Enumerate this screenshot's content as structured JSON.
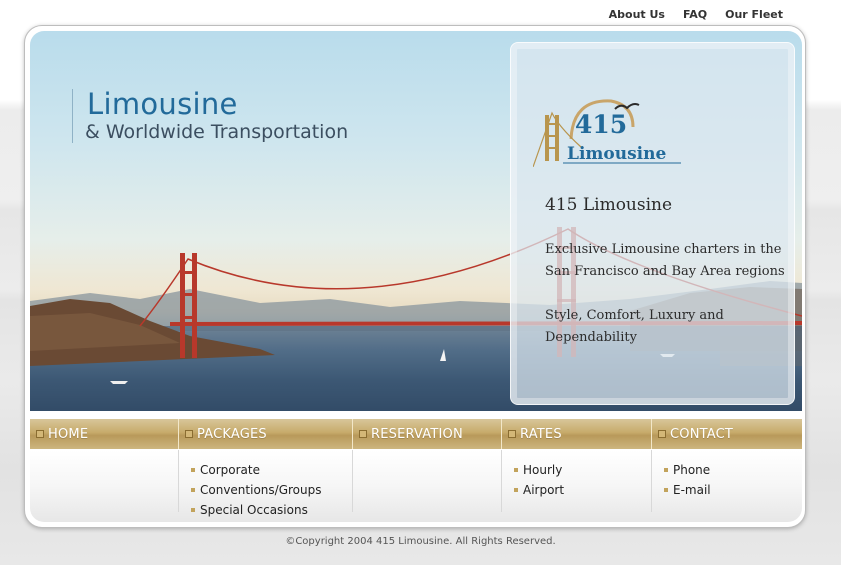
{
  "top_nav": [
    "About Us",
    "FAQ",
    "Our Fleet"
  ],
  "brand": {
    "title": "Limousine",
    "subtitle": "& Worldwide Transportation"
  },
  "logo": {
    "number": "415",
    "word": "Limousine"
  },
  "panel": {
    "heading": "415 Limousine",
    "para1": "Exclusive Limousine charters in the San Francisco and Bay Area regions",
    "para2": "Style, Comfort, Luxury and Dependability"
  },
  "menu": {
    "tabs": [
      {
        "label": "HOME",
        "items": []
      },
      {
        "label": "PACKAGES",
        "items": [
          "Corporate",
          "Conventions/Groups",
          "Special Occasions"
        ]
      },
      {
        "label": "RESERVATION",
        "items": []
      },
      {
        "label": "RATES",
        "items": [
          "Hourly",
          "Airport"
        ]
      },
      {
        "label": "CONTACT",
        "items": [
          "Phone",
          "E-mail"
        ]
      }
    ]
  },
  "footer": "©Copyright 2004 415 Limousine. All Rights Reserved.",
  "colors": {
    "brand_blue": "#226a9a",
    "gold": "#c7ab6b",
    "bridge_red": "#b8382b"
  }
}
